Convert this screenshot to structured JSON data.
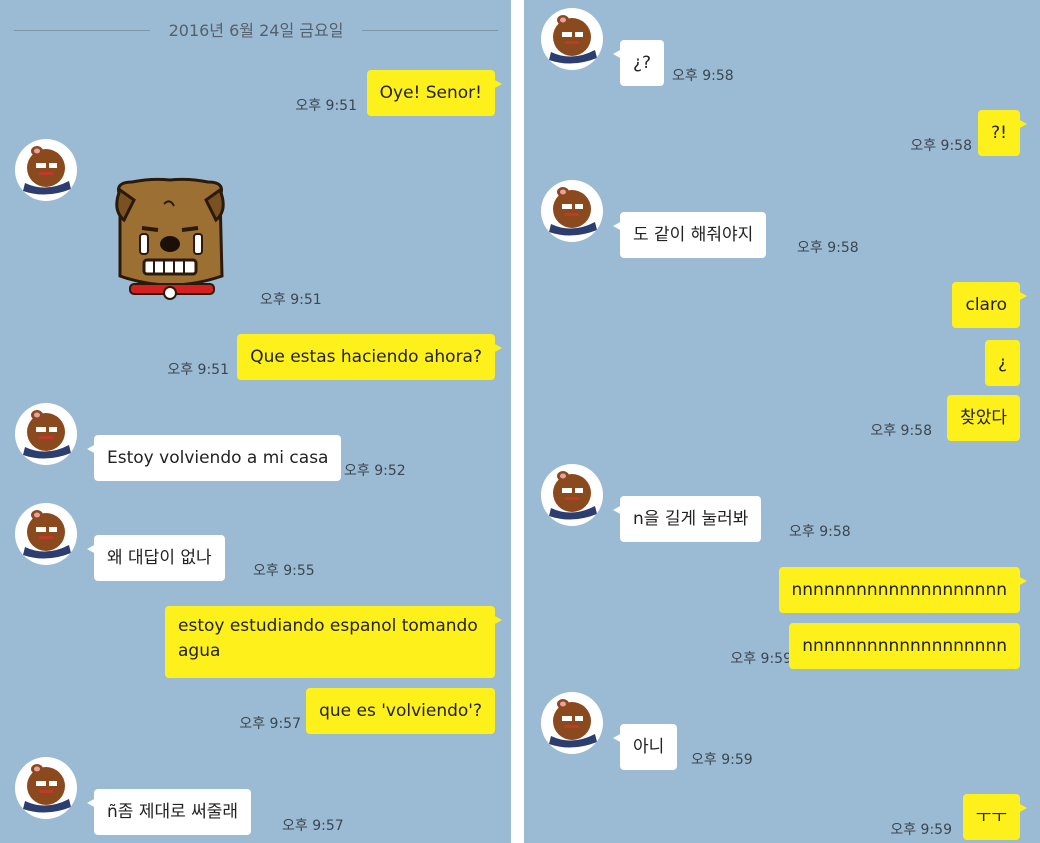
{
  "left": {
    "date": "2016년 6월 24일 금요일",
    "messages": [
      {
        "text": "Oye!  Senor!",
        "time": "오후 9:51"
      },
      {
        "time": "오후 9:51"
      },
      {
        "text": "Que estas haciendo ahora?",
        "time": "오후 9:51"
      },
      {
        "text": "Estoy volviendo a mi casa",
        "time": "오후 9:52"
      },
      {
        "text": "왜 대답이 없나",
        "time": "오후 9:55"
      },
      {
        "text": "estoy estudiando espanol tomando agua"
      },
      {
        "text": "que es 'volviendo'?",
        "time": "오후 9:57"
      },
      {
        "text": "ñ좀 제대로 써줄래",
        "time": "오후 9:57"
      }
    ]
  },
  "right": {
    "messages": [
      {
        "text": "¿?",
        "time": "오후 9:58"
      },
      {
        "text": "?!",
        "time": "오후 9:58"
      },
      {
        "text": "도 같이 해줘야지",
        "time": "오후 9:58"
      },
      {
        "text": "claro"
      },
      {
        "text": "¿"
      },
      {
        "text": "찾았다",
        "time": "오후 9:58"
      },
      {
        "text": "n을 길게 눌러봐",
        "time": "오후 9:58"
      },
      {
        "text": "nnnnnnnnnnnnnnnnnnnn"
      },
      {
        "text": "nnnnnnnnnnnnnnnnnnn",
        "time": "오후 9:59"
      },
      {
        "text": "아니",
        "time": "오후 9:59"
      },
      {
        "text": "ㅜㅜ",
        "time": "오후 9:59"
      }
    ]
  },
  "colors": {
    "background": "#9bbbd4",
    "my_bubble": "#fef01b",
    "other_bubble": "#ffffff"
  },
  "icons": {
    "avatar": "brown-character-avatar-icon",
    "sticker": "crying-dog-sticker"
  }
}
